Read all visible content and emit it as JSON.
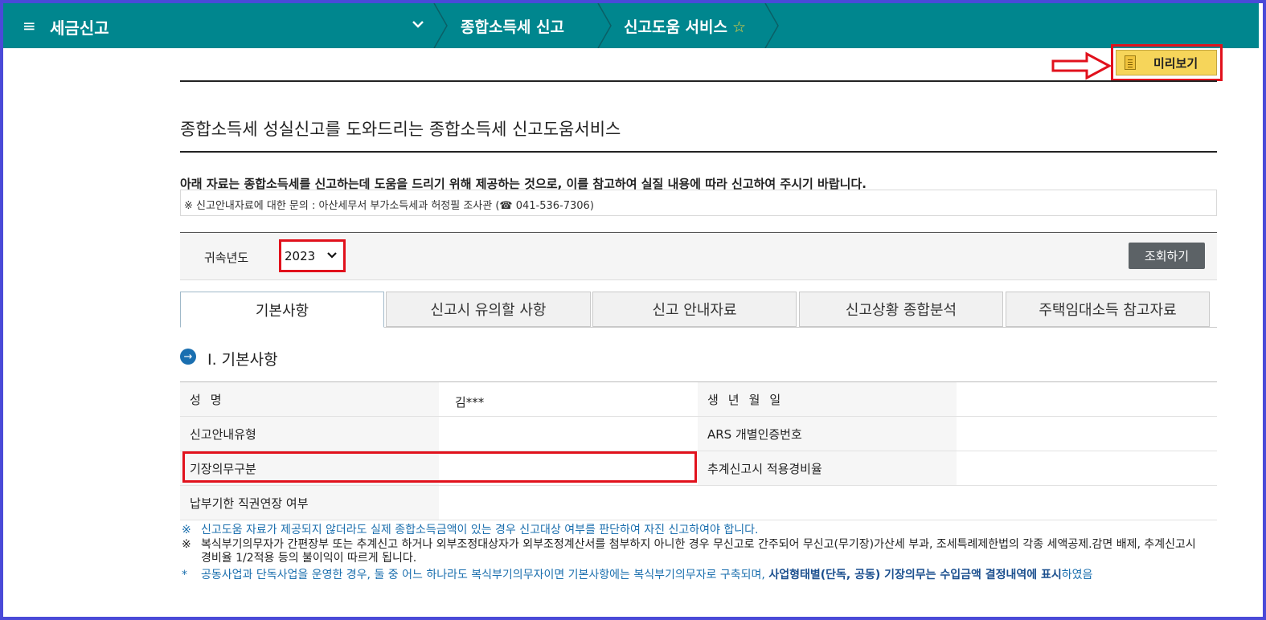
{
  "nav": {
    "menu_icon": "≡",
    "title": "세금신고",
    "dropdown_icon": "chevron-down",
    "crumbs": [
      "종합소득세 신고",
      "신고도움 서비스"
    ],
    "favorite_icon": "☆"
  },
  "preview": {
    "label": "미리보기"
  },
  "page": {
    "subtitle": "종합소득세 성실신고를 도와드리는 종합소득세 신고도움서비스",
    "notice": "아래 자료는 종합소득세를 신고하는데 도움을 드리기 위해 제공하는 것으로, 이를 참고하여 실질 내용에 따라 신고하여 주시기 바랍니다.",
    "contact": "※ 신고안내자료에 대한 문의 : 아산세무서 부가소득세과 허정필 조사관 (☎ 041-536-7306)"
  },
  "search": {
    "year_label": "귀속년도",
    "year_value": "2023",
    "query_label": "조회하기"
  },
  "tabs": [
    {
      "label": "기본사항",
      "active": true
    },
    {
      "label": "신고시 유의할 사항",
      "active": false
    },
    {
      "label": "신고 안내자료",
      "active": false
    },
    {
      "label": "신고상황 종합분석",
      "active": false
    },
    {
      "label": "주택임대소득 참고자료",
      "active": false
    }
  ],
  "section": {
    "icon": "→",
    "title": "Ⅰ. 기본사항"
  },
  "basic_table": {
    "rows": [
      {
        "label1": "성명",
        "value1": "김***",
        "label2": "생년월일",
        "value2": ""
      },
      {
        "label1": "신고안내유형",
        "value1": "",
        "label2": "ARS 개별인증번호",
        "value2": ""
      },
      {
        "label1": "기장의무구분",
        "value1": "",
        "label2": "추계신고시 적용경비율",
        "value2": ""
      },
      {
        "label1": "납부기한 직권연장 여부",
        "value1": ""
      }
    ]
  },
  "notes": {
    "n1_mark": "※",
    "n1": "신고도움 자료가 제공되지 않더라도 실제 종합소득금액이 있는 경우 신고대상 여부를 판단하여 자진 신고하여야 합니다.",
    "n2_mark": "※",
    "n2": "복식부기의무자가 간편장부 또는 추계신고 하거나 외부조정대상자가 외부조정계산서를 첨부하지 아니한 경우 무신고로 간주되어 무신고(무기장)가산세 부과, 조세특례제한법의 각종 세액공제.감면 배제, 추계신고시 경비율 1/2적용 등의 불이익이 따르게 됩니다.",
    "n3_mark": "*",
    "n3_a": "공동사업과 단독사업을 운영한 경우, 둘 중 어느 하나라도 복식부기의무자이면 기본사항에는 복식부기의무자로 구축되며, ",
    "n3_b": "사업형태별(단독, 공동) 기장의무는 수입금액 결정내역에 표시",
    "n3_c": "하였음"
  },
  "colors": {
    "topbar": "#00868e",
    "highlight_red": "#e1111c",
    "preview_yellow": "#f6d55a",
    "frame": "#4a4ad8",
    "note_blue": "#1b6fae"
  }
}
